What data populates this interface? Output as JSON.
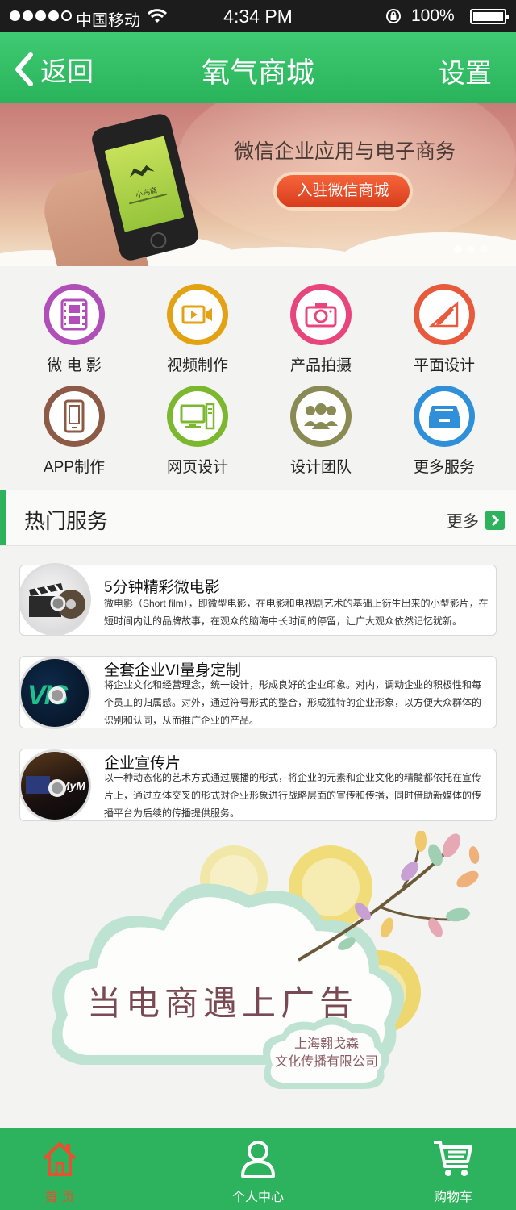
{
  "status": {
    "carrier": "中国移动",
    "time": "4:34 PM",
    "battery": "100%",
    "signal_bars_filled": 4,
    "signal_bars_total": 5,
    "battery_level": 1.0
  },
  "nav": {
    "back_label": "返回",
    "title": "氧气商城",
    "settings_label": "设置"
  },
  "banner": {
    "slogan": "微信企业应用与电子商务",
    "cta_label": "入驻微信商城",
    "phone_app_name": "小鸟商",
    "pages": 3,
    "active_page": 1
  },
  "grid": [
    {
      "label": "微 电 影",
      "icon": "film-icon",
      "color": "#b04fb8"
    },
    {
      "label": "视频制作",
      "icon": "video-camera-icon",
      "color": "#e2a214"
    },
    {
      "label": "产品拍摄",
      "icon": "camera-icon",
      "color": "#e9457d"
    },
    {
      "label": "平面设计",
      "icon": "pen-design-icon",
      "color": "#e85a3c"
    },
    {
      "label": "APP制作",
      "icon": "phone-icon",
      "color": "#8c5a45"
    },
    {
      "label": "网页设计",
      "icon": "desktop-computer-icon",
      "color": "#7cb82f"
    },
    {
      "label": "设计团队",
      "icon": "team-icon",
      "color": "#8a8a54"
    },
    {
      "label": "更多服务",
      "icon": "inbox-tray-icon",
      "color": "#2f8fd8"
    }
  ],
  "hot": {
    "title": "热门服务",
    "more_label": "更多"
  },
  "services": [
    {
      "title": "5分钟精彩微电影",
      "desc": "微电影（Short film），即微型电影，在电影和电视剧艺术的基础上衍生出来的小型影片，在短时间内让的品牌故事，在观众的脑海中长时间的停留，让广大观众依然记忆犹新。"
    },
    {
      "title": "全套企业VI量身定制",
      "desc": "将企业文化和经营理念，统一设计，形成良好的企业印象。对内，调动企业的积极性和每个员工的归属感。对外，通过符号形式的整合，形成独特的企业形象，以方便大众群体的识别和认同，从而推广企业的产品。",
      "thumb_text": "VIS"
    },
    {
      "title": "企业宣传片",
      "desc": "以一种动态化的艺术方式通过展播的形式，将企业的元素和企业文化的精髓都依托在宣传片上，通过立体交叉的形式对企业形象进行战略层面的宣传和传播，同时借助新媒体的传播平台为后续的传播提供服务。",
      "thumb_text": "MyM"
    }
  ],
  "promo": {
    "headline": "当电商遇上广告",
    "company_line1": "上海翱戈森",
    "company_line2": "文化传播有限公司"
  },
  "tabs": [
    {
      "label": "首 页",
      "icon": "home-icon",
      "active": true
    },
    {
      "label": "个人中心",
      "icon": "user-icon",
      "active": false
    },
    {
      "label": "购物车",
      "icon": "cart-icon",
      "active": false
    }
  ],
  "colors": {
    "brand_green": "#2db35d",
    "cta_orange": "#e84a26",
    "active_tab": "#e8502f"
  }
}
